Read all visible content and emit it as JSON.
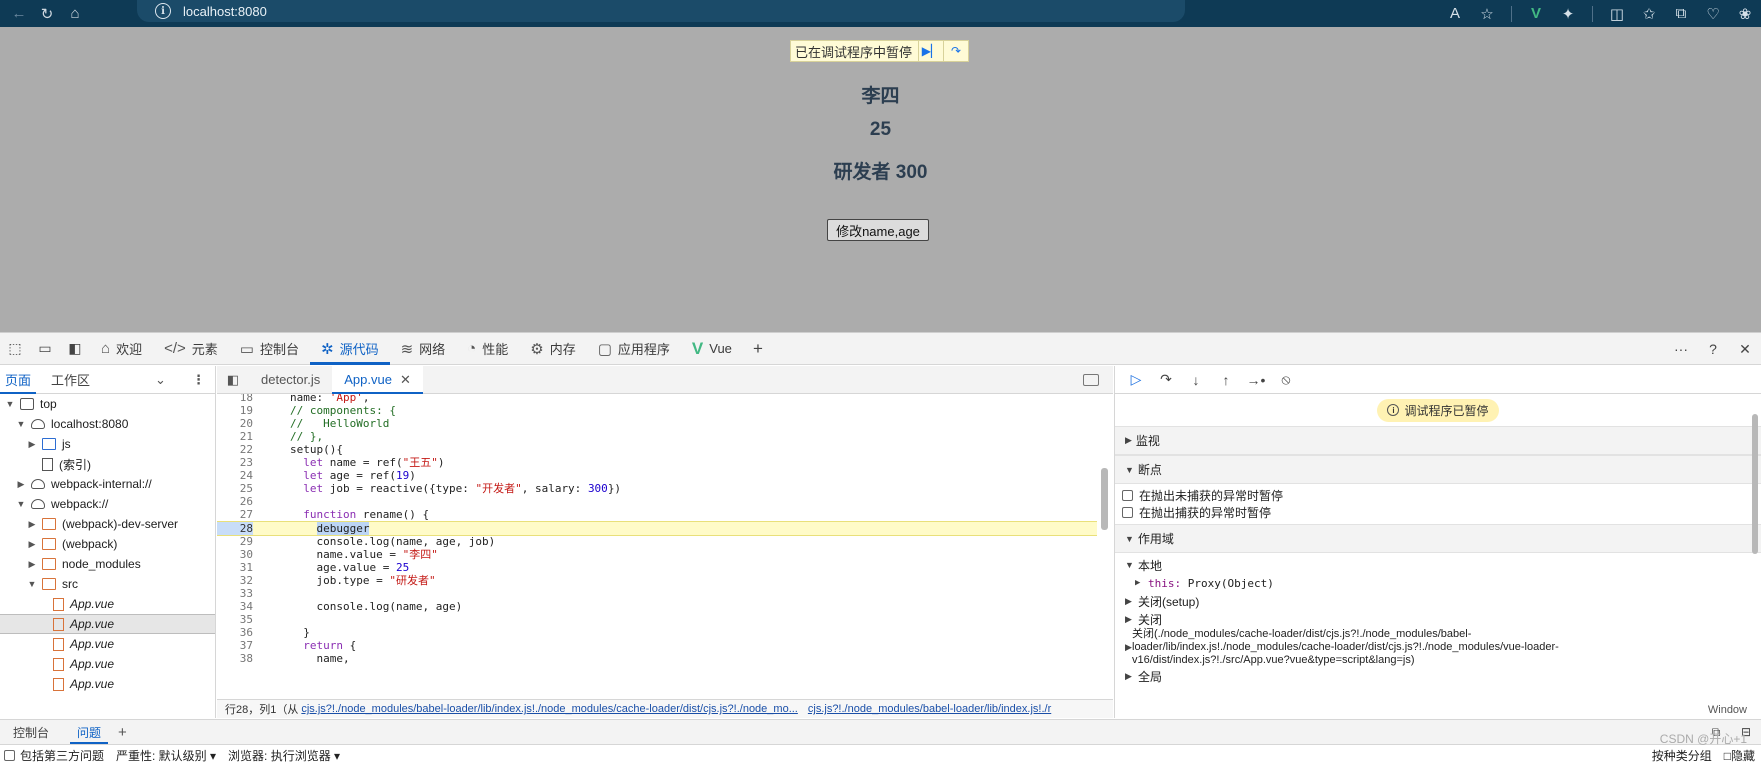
{
  "browser": {
    "address": "localhost:8080"
  },
  "page": {
    "paused_banner": "已在调试程序中暂停",
    "name": "李四",
    "age": "25",
    "job": "研发者 300",
    "modify_button": "修改name,age"
  },
  "devtools": {
    "tabs": [
      {
        "label": "欢迎",
        "icon": "home-icon"
      },
      {
        "label": "元素",
        "icon": "code-icon"
      },
      {
        "label": "控制台",
        "icon": "console-icon"
      },
      {
        "label": "源代码",
        "icon": "bug-icon"
      },
      {
        "label": "网络",
        "icon": "wifi-icon"
      },
      {
        "label": "性能",
        "icon": "gauge-icon"
      },
      {
        "label": "内存",
        "icon": "gear-icon"
      },
      {
        "label": "应用程序",
        "icon": "app-icon"
      },
      {
        "label": "Vue",
        "icon": "vue-logo-icon"
      }
    ],
    "left_panel": {
      "tab_page": "页面",
      "tab_workspace": "工作区",
      "tree": [
        {
          "label": "top",
          "icon": "frame",
          "depth": 0,
          "arrow": "▼"
        },
        {
          "label": "localhost:8080",
          "icon": "cloud",
          "depth": 1,
          "arrow": "▼"
        },
        {
          "label": "js",
          "icon": "folder-blue",
          "depth": 2,
          "arrow": "▶"
        },
        {
          "label": "(索引)",
          "icon": "file",
          "depth": 2,
          "arrow": ""
        },
        {
          "label": "webpack-internal://",
          "icon": "cloud",
          "depth": 1,
          "arrow": "▶"
        },
        {
          "label": "webpack://",
          "icon": "cloud",
          "depth": 1,
          "arrow": "▼"
        },
        {
          "label": "(webpack)-dev-server",
          "icon": "folder-orange",
          "depth": 2,
          "arrow": "▶"
        },
        {
          "label": "(webpack)",
          "icon": "folder-orange",
          "depth": 2,
          "arrow": "▶"
        },
        {
          "label": "node_modules",
          "icon": "folder-orange",
          "depth": 2,
          "arrow": "▶"
        },
        {
          "label": "src",
          "icon": "folder-orange",
          "depth": 2,
          "arrow": "▼"
        },
        {
          "label": "App.vue",
          "icon": "file-orange",
          "depth": 3,
          "arrow": ""
        },
        {
          "label": "App.vue",
          "icon": "file-orange",
          "depth": 3,
          "arrow": "",
          "selected": true
        },
        {
          "label": "App.vue",
          "icon": "file-orange",
          "depth": 3,
          "arrow": ""
        },
        {
          "label": "App.vue",
          "icon": "file-orange",
          "depth": 3,
          "arrow": ""
        },
        {
          "label": "App.vue",
          "icon": "file-orange",
          "depth": 3,
          "arrow": ""
        }
      ]
    },
    "editor": {
      "tab1": "detector.js",
      "tab2": "App.vue",
      "lines": [
        {
          "n": "18",
          "code": "name: 'App',"
        },
        {
          "n": "19",
          "code": "// components: {"
        },
        {
          "n": "20",
          "code": "//   HelloWorld"
        },
        {
          "n": "21",
          "code": "// },"
        },
        {
          "n": "22",
          "code": "setup(){"
        },
        {
          "n": "23",
          "code": "  let name = ref(\"王五\")"
        },
        {
          "n": "24",
          "code": "  let age = ref(19)"
        },
        {
          "n": "25",
          "code": "  let job = reactive({type: \"开发者\", salary: 300})"
        },
        {
          "n": "26",
          "code": ""
        },
        {
          "n": "27",
          "code": "  function rename() {"
        },
        {
          "n": "28",
          "code": "    debugger"
        },
        {
          "n": "29",
          "code": "    console.log(name, age, job)"
        },
        {
          "n": "30",
          "code": "    name.value = \"李四\""
        },
        {
          "n": "31",
          "code": "    age.value = 25"
        },
        {
          "n": "32",
          "code": "    job.type = \"研发者\""
        },
        {
          "n": "33",
          "code": ""
        },
        {
          "n": "34",
          "code": "    console.log(name, age)"
        },
        {
          "n": "35",
          "code": ""
        },
        {
          "n": "36",
          "code": "  }"
        },
        {
          "n": "37",
          "code": "  return {"
        },
        {
          "n": "38",
          "code": "    name,"
        }
      ],
      "status_prefix": "行28，列1（从",
      "status_link1": "cjs.js?!./node_modules/babel-loader/lib/index.js!./node_modules/cache-loader/dist/cjs.js?!./node_mo...",
      "status_link2": "cjs.js?!./node_modules/babel-loader/lib/index.js!./r"
    },
    "debugger": {
      "paused_pill": "调试程序已暂停",
      "watch": "监视",
      "breakpoints": "断点",
      "cb_uncaught": "在抛出未捕获的异常时暂停",
      "cb_caught": "在抛出捕获的异常时暂停",
      "scope": "作用域",
      "local": "本地",
      "this_key": "this:",
      "this_val": "Proxy(Object)",
      "closure_setup": "关闭(setup)",
      "closure": "关闭",
      "closure_long_1": "关闭(./node_modules/cache-loader/dist/cjs.js?!./node_modules/babel-",
      "closure_long_2": "loader/lib/index.js!./node_modules/cache-loader/dist/cjs.js?!./node_modules/vue-loader-",
      "closure_long_3": "v16/dist/index.js?!./src/App.vue?vue&type=script&lang=js)",
      "global": "全局",
      "window": "Window"
    },
    "drawer": {
      "tab_console": "控制台",
      "tab_issues": "问题",
      "sub_text": "包括第三方问题　严重性: 默认级别 ▾　浏览器: 执行浏览器 ▾",
      "right_text": "按种类分组　□隐藏",
      "watermark": "CSDN @开心+1"
    }
  },
  "colors": {
    "accent": "#0f62c5",
    "page_bg": "#acacac",
    "browser_bar": "#0e3a55",
    "vue_green": "#42b883"
  }
}
